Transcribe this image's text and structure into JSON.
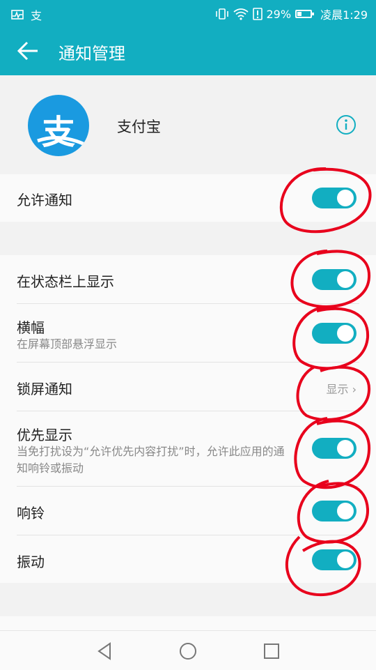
{
  "statusbar": {
    "battery_percent": "29%",
    "time": "凌晨1:29",
    "notification_icons": [
      "activity-icon",
      "alipay-notification-icon"
    ],
    "status_icons": [
      "vibrate-icon",
      "wifi-icon",
      "sim-alert-icon",
      "battery-icon"
    ]
  },
  "appbar": {
    "title": "通知管理",
    "back_icon": "back-arrow-icon"
  },
  "app": {
    "name": "支付宝",
    "logo_glyph": "支",
    "info_icon": "info-icon"
  },
  "settings": {
    "allow_notifications": {
      "label": "允许通知",
      "enabled": true
    },
    "status_bar": {
      "label": "在状态栏上显示",
      "enabled": true
    },
    "banner": {
      "label": "横幅",
      "sub": "在屏幕顶部悬浮显示",
      "enabled": true
    },
    "lock_screen": {
      "label": "锁屏通知",
      "value": "显示"
    },
    "priority": {
      "label": "优先显示",
      "sub": "当免打扰设为“允许优先内容打扰”时，允许此应用的通知响铃或振动",
      "enabled": true
    },
    "ring": {
      "label": "响铃",
      "enabled": true
    },
    "vibrate": {
      "label": "振动",
      "enabled": true
    },
    "partial_next": {
      "label": "..."
    }
  },
  "navbar": {
    "icons": [
      "back-triangle-icon",
      "home-circle-icon",
      "recents-square-icon"
    ]
  },
  "colors": {
    "accent": "#12aec1",
    "logo": "#1a9ae0",
    "annotation": "#e8001c"
  }
}
